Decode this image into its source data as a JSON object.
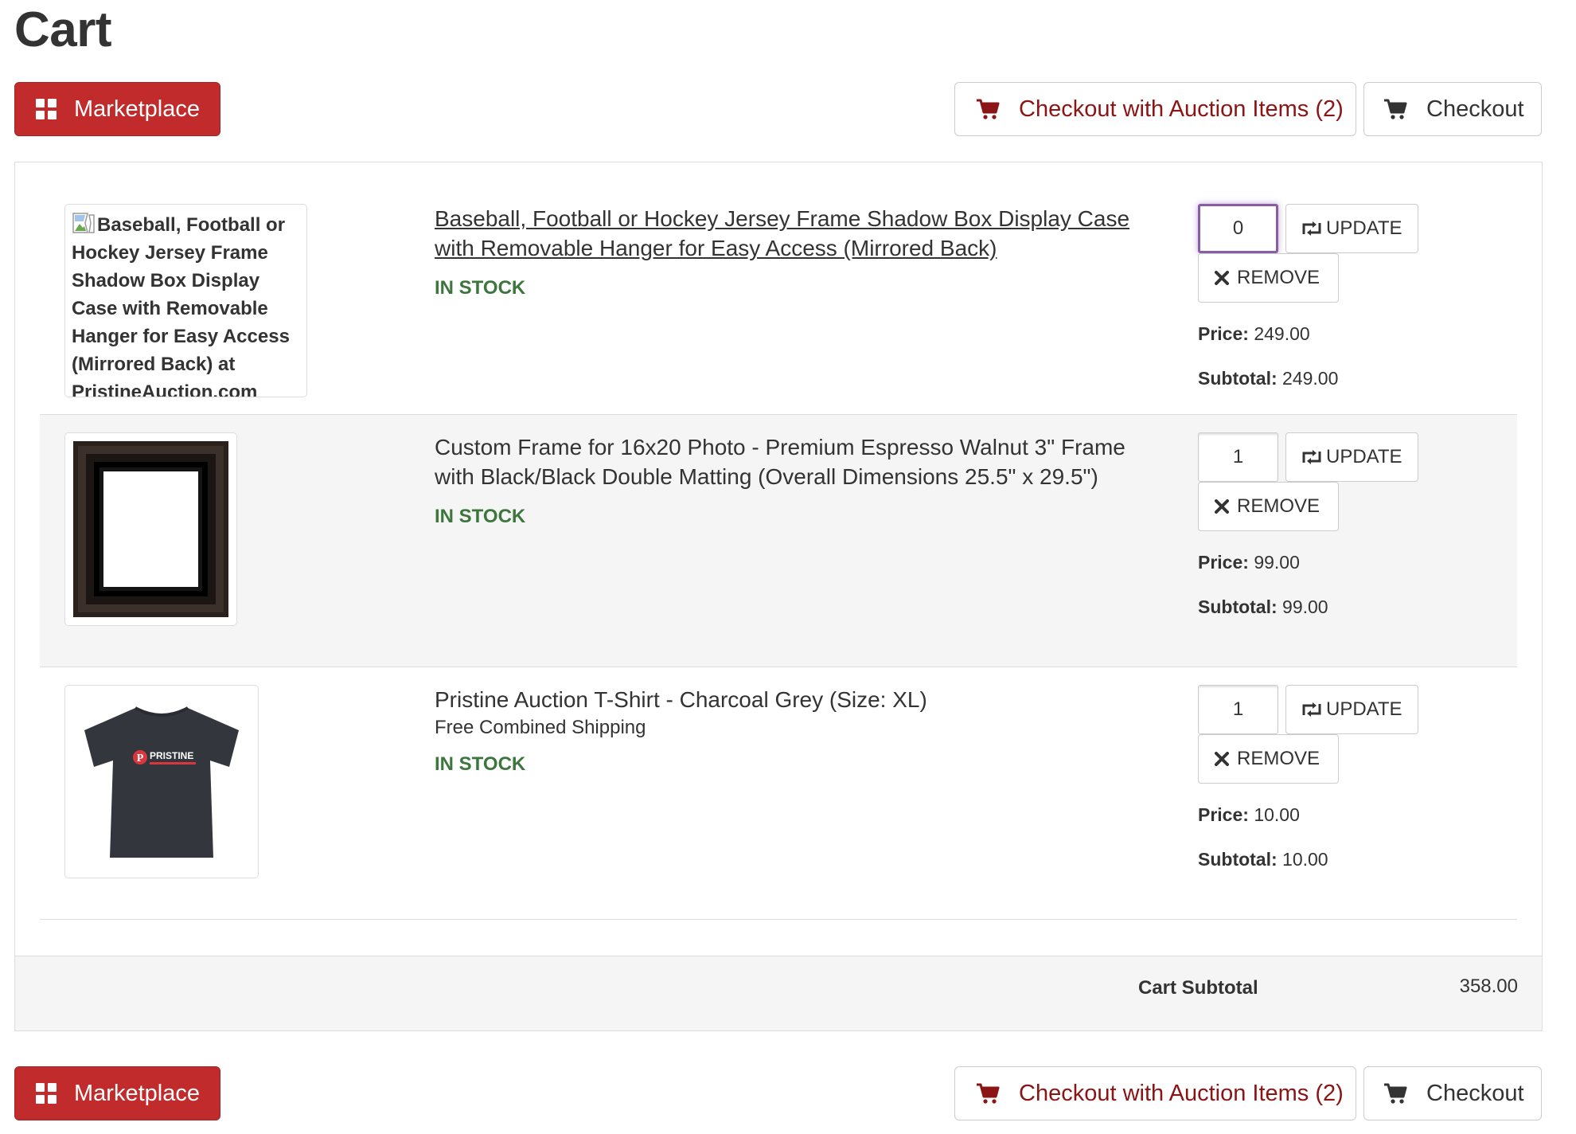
{
  "page": {
    "title": "Cart"
  },
  "toolbar": {
    "marketplace_label": "Marketplace",
    "checkout_auction_label": "Checkout with Auction Items (2)",
    "checkout_label": "Checkout"
  },
  "items": [
    {
      "title": "Baseball, Football or Hockey Jersey Frame Shadow Box Display Case with Removable Hanger for Easy Access (Mirrored Back)",
      "image_alt": "Baseball, Football or Hockey Jersey Frame Shadow Box Display Case with Removable Hanger for Easy Access (Mirrored Back) at PristineAuction.com",
      "note": "",
      "stock": "IN STOCK",
      "quantity": "0",
      "update_label": "UPDATE",
      "remove_label": "REMOVE",
      "price_label": "Price:",
      "price": "249.00",
      "subtotal_label": "Subtotal:",
      "subtotal": "249.00"
    },
    {
      "title": "Custom Frame for 16x20 Photo - Premium Espresso Walnut 3\" Frame with Black/Black Double Matting (Overall Dimensions 25.5\" x 29.5\")",
      "note": "",
      "stock": "IN STOCK",
      "quantity": "1",
      "update_label": "UPDATE",
      "remove_label": "REMOVE",
      "price_label": "Price:",
      "price": "99.00",
      "subtotal_label": "Subtotal:",
      "subtotal": "99.00"
    },
    {
      "title": "Pristine Auction T-Shirt - Charcoal Grey (Size: XL)",
      "note": "Free Combined Shipping",
      "stock": "IN STOCK",
      "quantity": "1",
      "update_label": "UPDATE",
      "remove_label": "REMOVE",
      "price_label": "Price:",
      "price": "10.00",
      "subtotal_label": "Subtotal:",
      "subtotal": "10.00",
      "shirt_print": "PRISTINE"
    }
  ],
  "cart": {
    "subtotal_label": "Cart Subtotal",
    "subtotal": "358.00"
  },
  "icons": {
    "marketplace": "grid-icon",
    "checkout_auction": "cart-icon",
    "checkout": "cart-icon",
    "update": "refresh-icon",
    "remove": "close-icon",
    "broken_image": "broken-image-icon"
  },
  "colors": {
    "brand_red": "#c12b2b",
    "auction_text": "#8b1414",
    "in_stock": "#3c763d",
    "focus": "#8a5ca8",
    "row_alt": "#f5f5f5"
  }
}
